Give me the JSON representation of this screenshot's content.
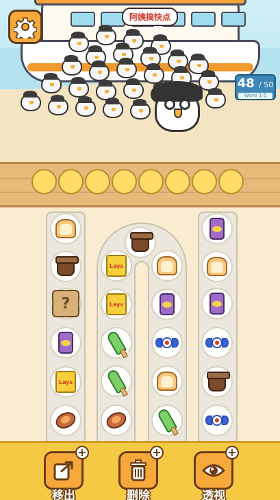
{
  "header": {
    "speech_bubble": "阿姨搞快点",
    "settings_icon": "gear-icon"
  },
  "counter": {
    "current": "48",
    "total": "/ 50",
    "sub_label": "Wave 1-5"
  },
  "slots": {
    "count": 8,
    "filled": 0
  },
  "board": {
    "left_column": [
      "bread",
      "coffee-cup",
      "mystery-box",
      "purple-can",
      "chips",
      "sweet-potato"
    ],
    "arch_left": [
      "chips",
      "chips",
      "popsicle",
      "popsicle",
      "sweet-potato"
    ],
    "arch_top": [
      "coffee-cup"
    ],
    "arch_right": [
      "bread",
      "purple-can",
      "candy",
      "bread",
      "popsicle"
    ],
    "right_column": [
      "purple-can",
      "bread",
      "purple-can",
      "candy",
      "coffee-cup",
      "candy"
    ],
    "chips_brand": "Lays",
    "mystery_mark": "?"
  },
  "tools": [
    {
      "label": "移出",
      "icon": "move-out-icon"
    },
    {
      "label": "删除",
      "icon": "trash-icon"
    },
    {
      "label": "透视",
      "icon": "eye-icon"
    }
  ],
  "colors": {
    "accent": "#f6a93a",
    "toolbar": "#f6c945",
    "slot": "#ffdd66",
    "counter": "#3d86b8"
  }
}
